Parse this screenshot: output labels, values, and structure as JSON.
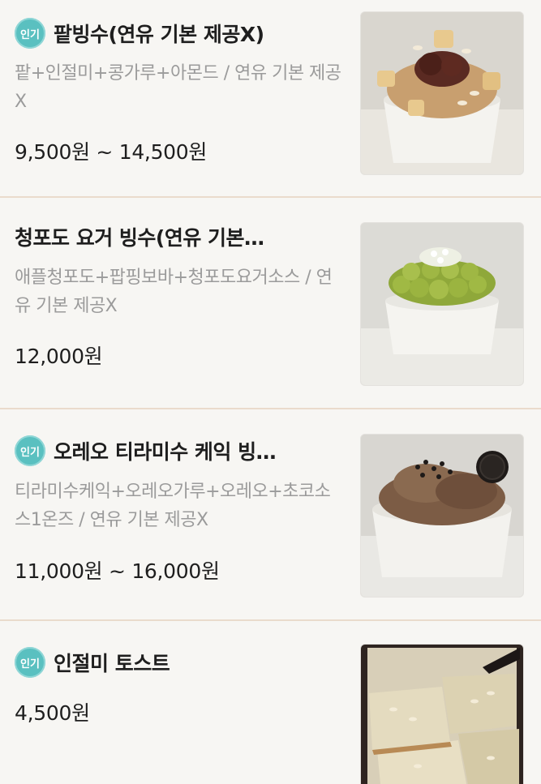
{
  "badge_label": "인기",
  "items": [
    {
      "title": "팥빙수(연유 기본 제공X)",
      "description": "팥+인절미+콩가루+아몬드 / 연유 기본 제공X",
      "price": "9,500원 ~ 14,500원",
      "popular": true,
      "image": "bingsu-red-bean-photo"
    },
    {
      "title": "청포도 요거 빙수(연유 기본…",
      "description": "애플청포도+팝핑보바+청포도요거소스 / 연유 기본 제공X",
      "price": "12,000원",
      "popular": false,
      "image": "bingsu-green-grape-photo"
    },
    {
      "title": "오레오 티라미수 케익 빙…",
      "description": "티라미수케익+오레오가루+오레오+초코소스1온즈 / 연유 기본 제공X",
      "price": "11,000원 ~ 16,000원",
      "popular": true,
      "image": "bingsu-oreo-tiramisu-photo"
    },
    {
      "title": "인절미 토스트",
      "description": "",
      "price": "4,500원",
      "popular": true,
      "image": "injeolmi-toast-photo"
    }
  ],
  "colors": {
    "badge": "#5ac0c0",
    "divider": "#eadbcc",
    "description": "#9b9b9b",
    "background": "#f7f6f3"
  }
}
